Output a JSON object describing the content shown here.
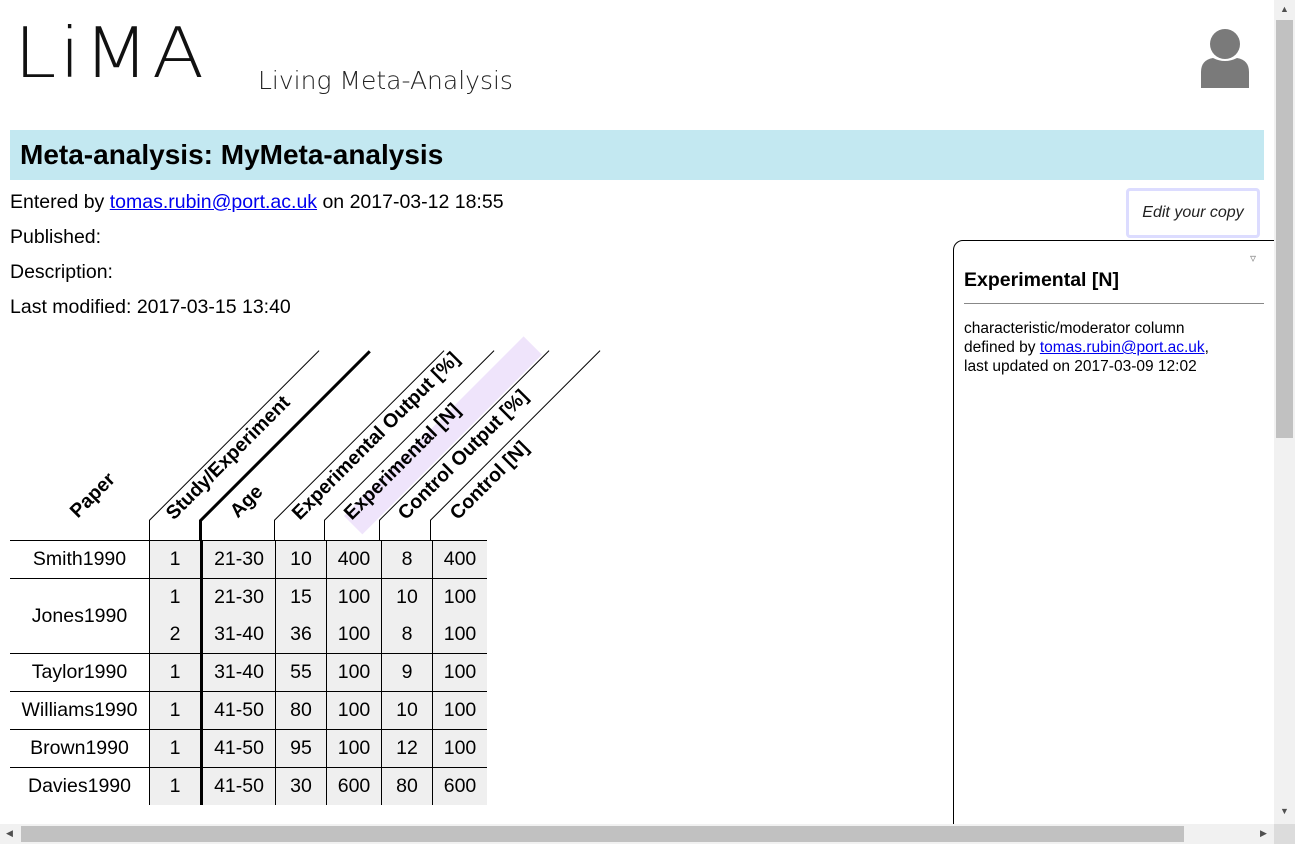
{
  "header": {
    "logo": "LiMA",
    "tagline": "Living Meta-Analysis",
    "user_icon": "user-avatar-icon"
  },
  "title": "Meta-analysis: MyMeta-analysis",
  "meta": {
    "entered_prefix": "Entered by ",
    "entered_email": "tomas.rubin@port.ac.uk",
    "entered_suffix": " on 2017-03-12 18:55",
    "published": "Published:",
    "description": "Description:",
    "last_modified": "Last modified: 2017-03-15 13:40"
  },
  "edit_button": "Edit your copy",
  "panel": {
    "toggle": "▿",
    "title": "Experimental [N]",
    "line1": "characteristic/moderator column",
    "line2_prefix": "defined by ",
    "line2_email": "tomas.rubin@port.ac.uk",
    "line2_suffix": ",",
    "line3": "last updated on 2017-03-09 12:02"
  },
  "columns": {
    "paper": "Paper",
    "study": "Study/Experiment",
    "age": "Age",
    "exp_output": "Experimental Output [%]",
    "exp_n": "Experimental [N]",
    "ctrl_output": "Control Output [%]",
    "ctrl_n": "Control [N]"
  },
  "highlight_color": "#efe4fb",
  "rows": [
    {
      "paper": "Smith1990",
      "study": "1",
      "age": "21-30",
      "eo": "10",
      "en": "400",
      "co": "8",
      "cn": "400"
    },
    {
      "paper": "Jones1990",
      "study": "1",
      "age": "21-30",
      "eo": "15",
      "en": "100",
      "co": "10",
      "cn": "100"
    },
    {
      "paper": "",
      "study": "2",
      "age": "31-40",
      "eo": "36",
      "en": "100",
      "co": "8",
      "cn": "100"
    },
    {
      "paper": "Taylor1990",
      "study": "1",
      "age": "31-40",
      "eo": "55",
      "en": "100",
      "co": "9",
      "cn": "100"
    },
    {
      "paper": "Williams1990",
      "study": "1",
      "age": "41-50",
      "eo": "80",
      "en": "100",
      "co": "10",
      "cn": "100"
    },
    {
      "paper": "Brown1990",
      "study": "1",
      "age": "41-50",
      "eo": "95",
      "en": "100",
      "co": "12",
      "cn": "100"
    },
    {
      "paper": "Davies1990",
      "study": "1",
      "age": "41-50",
      "eo": "30",
      "en": "600",
      "co": "80",
      "cn": "600"
    }
  ]
}
